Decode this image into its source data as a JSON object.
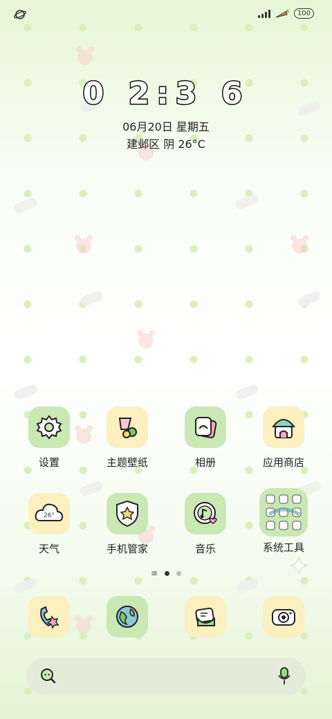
{
  "status_bar": {
    "battery": "100"
  },
  "lock": {
    "time": "0 2:3 6",
    "date": "06月20日 星期五",
    "weather": "建邺区 阴 26°C"
  },
  "apps": [
    {
      "label": "设置",
      "icon": "settings-gear-icon"
    },
    {
      "label": "主题壁纸",
      "icon": "theme-wallpaper-icon"
    },
    {
      "label": "相册",
      "icon": "gallery-photo-icon"
    },
    {
      "label": "应用商店",
      "icon": "app-store-icon"
    },
    {
      "label": "天气",
      "icon": "weather-cloud-icon",
      "icon_text": "26°"
    },
    {
      "label": "手机管家",
      "icon": "phone-manager-shield-icon"
    },
    {
      "label": "音乐",
      "icon": "music-note-icon"
    },
    {
      "label": "系统工具",
      "icon": "system-tools-folder-icon"
    }
  ],
  "page_indicator": {
    "pages": 2,
    "current": 1
  },
  "dock": [
    {
      "icon": "phone-icon"
    },
    {
      "icon": "browser-globe-icon"
    },
    {
      "icon": "messages-icon"
    },
    {
      "icon": "camera-icon"
    }
  ],
  "colors": {
    "icon_green": "#c9e8b4",
    "icon_yellow": "#fcefc0",
    "search_bar": "#e3ecd9"
  }
}
